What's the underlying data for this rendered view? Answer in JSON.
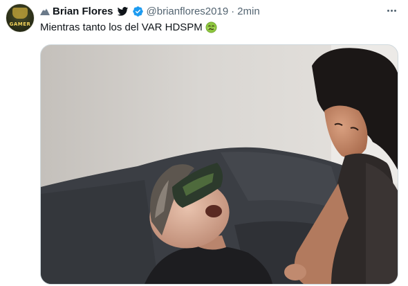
{
  "tweet": {
    "author": {
      "name": "Brian Flores",
      "handle": "@brianflores2019",
      "avatar_text": "GAMER"
    },
    "separator": "·",
    "time": "2min",
    "text": "Mientras tanto los del VAR HDSPM",
    "emoji": "nauseated-face-emoji",
    "media": {
      "type": "gif-frame",
      "description_icon": "photo"
    }
  },
  "colors": {
    "text": "#0f1419",
    "secondary": "#536471",
    "verified": "#1d9bf0",
    "border": "#cfd9de"
  }
}
